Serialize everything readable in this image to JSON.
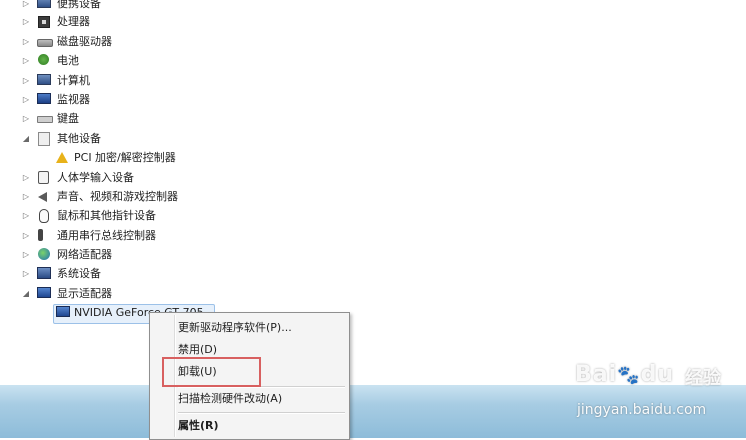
{
  "tree": {
    "items": [
      {
        "label": "便携设备",
        "arrow": "▷",
        "icon": "computer-icon"
      },
      {
        "label": "处理器",
        "arrow": "▷",
        "icon": "processor-icon"
      },
      {
        "label": "磁盘驱动器",
        "arrow": "▷",
        "icon": "disk-drive-icon"
      },
      {
        "label": "电池",
        "arrow": "▷",
        "icon": "battery-icon"
      },
      {
        "label": "计算机",
        "arrow": "▷",
        "icon": "computer-icon"
      },
      {
        "label": "监视器",
        "arrow": "▷",
        "icon": "monitor-icon"
      },
      {
        "label": "键盘",
        "arrow": "▷",
        "icon": "keyboard-icon"
      },
      {
        "label": "其他设备",
        "arrow": "◢",
        "icon": "other-devices-icon"
      },
      {
        "label": "PCI 加密/解密控制器",
        "arrow": "",
        "icon": "warning-icon"
      },
      {
        "label": "人体学输入设备",
        "arrow": "▷",
        "icon": "hid-icon"
      },
      {
        "label": "声音、视频和游戏控制器",
        "arrow": "▷",
        "icon": "sound-icon"
      },
      {
        "label": "鼠标和其他指针设备",
        "arrow": "▷",
        "icon": "mouse-icon"
      },
      {
        "label": "通用串行总线控制器",
        "arrow": "▷",
        "icon": "usb-icon"
      },
      {
        "label": "网络适配器",
        "arrow": "▷",
        "icon": "network-icon"
      },
      {
        "label": "系统设备",
        "arrow": "▷",
        "icon": "system-icon"
      },
      {
        "label": "显示适配器",
        "arrow": "◢",
        "icon": "display-adapter-icon"
      },
      {
        "label": "NVIDIA GeForce GT 705",
        "arrow": "",
        "icon": "display-adapter-icon"
      }
    ]
  },
  "context_menu": {
    "items": [
      {
        "label": "更新驱动程序软件(P)..."
      },
      {
        "label": "禁用(D)"
      },
      {
        "label": "卸载(U)"
      },
      {
        "label": "扫描检测硬件改动(A)"
      },
      {
        "label": "属性(R)"
      }
    ]
  },
  "watermark": {
    "logo": "Bai",
    "logo_suffix": "du",
    "cn": "经验",
    "url": "jingyan.baidu.com"
  }
}
